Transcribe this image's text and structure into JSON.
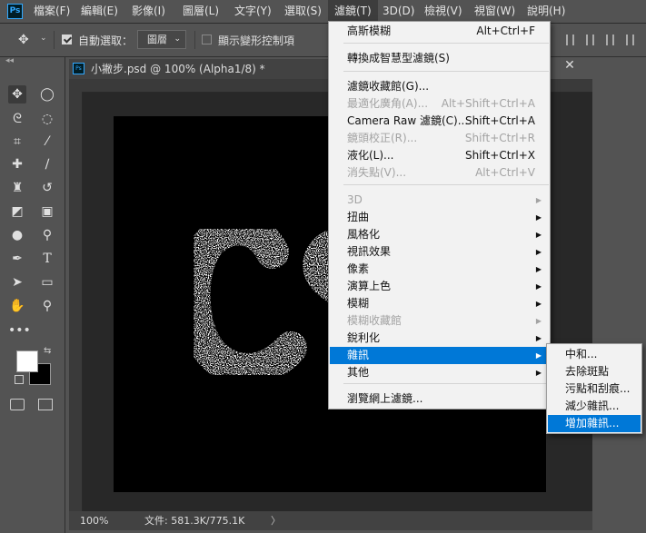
{
  "menubar": {
    "items": [
      "檔案(F)",
      "編輯(E)",
      "影像(I)",
      "圖層(L)",
      "文字(Y)",
      "選取(S)",
      "濾鏡(T)",
      "3D(D)",
      "檢視(V)",
      "視窗(W)",
      "說明(H)"
    ],
    "active_index": 6
  },
  "options": {
    "auto_select_label": "自動選取：",
    "auto_select_checked": true,
    "auto_select_target": "圖層",
    "show_transform_label": "顯示變形控制項",
    "show_transform_checked": false
  },
  "document": {
    "tab_title": "小撇步.psd @ 100% (Alpha1/8) *",
    "zoom": "100%",
    "doc_info": "文件: 581.3K/775.1K"
  },
  "filter_menu": {
    "items": [
      {
        "label": "高斯模糊",
        "shortcut": "Alt+Ctrl+F",
        "enabled": true
      },
      {
        "label": "轉換成智慧型濾鏡(S)",
        "shortcut": "",
        "enabled": true
      },
      {
        "label": "濾鏡收藏館(G)...",
        "shortcut": "",
        "enabled": true
      },
      {
        "label": "最適化廣角(A)...",
        "shortcut": "Alt+Shift+Ctrl+A",
        "enabled": false
      },
      {
        "label": "Camera Raw 濾鏡(C)...",
        "shortcut": "Shift+Ctrl+A",
        "enabled": true
      },
      {
        "label": "鏡頭校正(R)...",
        "shortcut": "Shift+Ctrl+R",
        "enabled": false
      },
      {
        "label": "液化(L)...",
        "shortcut": "Shift+Ctrl+X",
        "enabled": true
      },
      {
        "label": "消失點(V)...",
        "shortcut": "Alt+Ctrl+V",
        "enabled": false
      },
      {
        "label": "3D",
        "submenu": true,
        "enabled": false
      },
      {
        "label": "扭曲",
        "submenu": true,
        "enabled": true
      },
      {
        "label": "風格化",
        "submenu": true,
        "enabled": true
      },
      {
        "label": "視訊效果",
        "submenu": true,
        "enabled": true
      },
      {
        "label": "像素",
        "submenu": true,
        "enabled": true
      },
      {
        "label": "演算上色",
        "submenu": true,
        "enabled": true
      },
      {
        "label": "模糊",
        "submenu": true,
        "enabled": true
      },
      {
        "label": "模糊收藏館",
        "submenu": true,
        "enabled": false
      },
      {
        "label": "銳利化",
        "submenu": true,
        "enabled": true
      },
      {
        "label": "雜訊",
        "submenu": true,
        "enabled": true,
        "highlighted": true
      },
      {
        "label": "其他",
        "submenu": true,
        "enabled": true
      },
      {
        "label": "瀏覽網上濾鏡...",
        "shortcut": "",
        "enabled": true
      }
    ]
  },
  "noise_submenu": {
    "items": [
      "中和...",
      "去除斑點",
      "污點和刮痕...",
      "減少雜訊...",
      "增加雜訊..."
    ],
    "highlighted_index": 4
  },
  "colors": {
    "foreground": "#ffffff",
    "background": "#000000",
    "highlight": "#0078d7"
  },
  "icons": {
    "move": "move-icon",
    "marquee": "marquee-icon",
    "lasso": "lasso-icon",
    "quick-select": "quick-select-icon",
    "crop": "crop-icon",
    "eyedropper": "eyedropper-icon",
    "healing": "healing-brush-icon",
    "brush": "brush-icon",
    "stamp": "clone-stamp-icon",
    "history-brush": "history-brush-icon",
    "eraser": "eraser-icon",
    "gradient": "gradient-icon",
    "blur": "blur-icon",
    "dodge": "dodge-icon",
    "pen": "pen-icon",
    "type": "type-icon",
    "path-select": "path-selection-icon",
    "rectangle": "rectangle-icon",
    "hand": "hand-icon",
    "zoom": "zoom-icon",
    "more": "more-tools-icon"
  }
}
